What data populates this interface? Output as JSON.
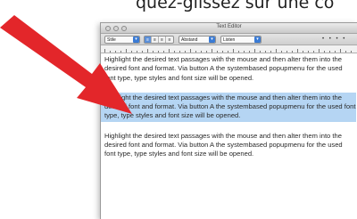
{
  "caption": "quez-glissez sur une co",
  "window": {
    "title": "Text Editor",
    "toolbar": {
      "style_select": "Stile",
      "spacing_label": "Abstand",
      "lists_select": "Listen",
      "align_buttons": [
        "≡",
        "≡",
        "≡",
        "≡"
      ],
      "spacing_glyphs": "• • • •"
    },
    "paragraphs": [
      {
        "text": "Highlight the desired text passages with the mouse and then alter them into the desired font and format. Via button A the systembased popupmenu for the used font type, type styles and font size will be opened.",
        "highlighted": false
      },
      {
        "text": "Highlight the desired text passages with the mouse and then alter them into the desired font and format. Via button A the systembased popupmenu for the used font type, type styles and font size will be opened.",
        "highlighted": true
      },
      {
        "text": "Highlight the desired text passages with the mouse and then alter them into the desired font and format. Via button A the systembased popupmenu for the used font type, type styles and font size will be opened.",
        "highlighted": false
      }
    ]
  },
  "colors": {
    "arrow": "#e3262a",
    "highlight": "#b5d5f3",
    "accent": "#3a7bd5"
  }
}
